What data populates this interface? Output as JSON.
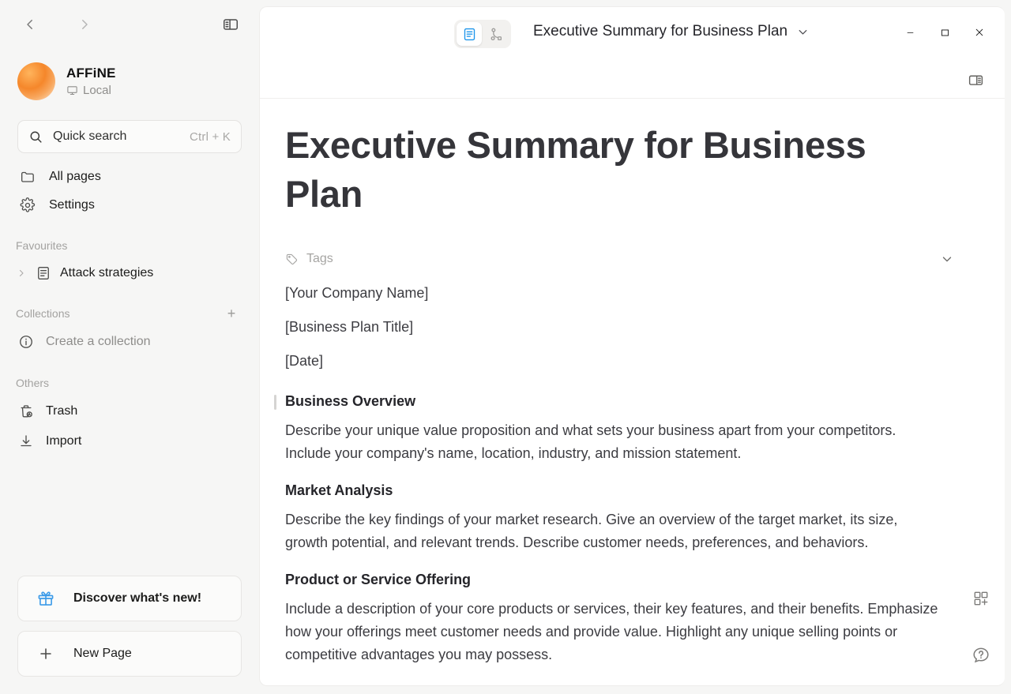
{
  "sidebar": {
    "nav_back": "back-arrow",
    "nav_forward": "forward-arrow",
    "panel_toggle": "toggle-sidebar",
    "workspace": {
      "name": "AFFiNE",
      "sub_label": "Local"
    },
    "quick_search": {
      "label": "Quick search",
      "shortcut": "Ctrl + K"
    },
    "nav_items": [
      {
        "label": "All pages",
        "icon": "folder-icon"
      },
      {
        "label": "Settings",
        "icon": "gear-icon"
      }
    ],
    "favourites": {
      "section_label": "Favourites",
      "items": [
        {
          "label": "Attack strategies",
          "icon": "doc-icon"
        }
      ]
    },
    "collections": {
      "section_label": "Collections",
      "add_label": "+",
      "items": [
        {
          "label": "Create a collection",
          "icon": "info-icon"
        }
      ]
    },
    "others": {
      "section_label": "Others",
      "items": [
        {
          "label": "Trash",
          "icon": "trash-icon"
        },
        {
          "label": "Import",
          "icon": "import-icon"
        }
      ]
    },
    "bottom": {
      "discover_label": "Discover what's new!",
      "new_page_label": "New Page"
    }
  },
  "header": {
    "mode_page": "page-mode",
    "mode_edgeless": "edgeless-mode",
    "doc_title": "Executive Summary for Business Plan",
    "minimize": "minimize",
    "maximize": "maximize",
    "close": "close",
    "right_panel_toggle": "toggle-right-sidebar"
  },
  "document": {
    "title": "Executive Summary for Business Plan",
    "tags_label": "Tags",
    "placeholders": [
      "[Your Company Name]",
      "[Business Plan Title]",
      "[Date]"
    ],
    "sections": [
      {
        "heading": "Business Overview",
        "body": "Describe your unique value proposition and what sets your business apart from your competitors. Include your company's name, location, industry, and mission statement."
      },
      {
        "heading": "Market Analysis",
        "body": "Describe the key findings of your market research. Give an overview of the target market, its size, growth potential, and relevant trends. Describe customer needs, preferences, and behaviors."
      },
      {
        "heading": "Product or Service Offering",
        "body": "Include a description of your core products or services, their key features, and their benefits. Emphasize how your offerings meet customer needs and provide value. Highlight any unique selling points or competitive advantages you may possess."
      }
    ]
  },
  "fabs": {
    "add_widget": "add-block",
    "help": "help"
  },
  "colors": {
    "accent_blue": "#1e96eb",
    "workspace_orange": "#f5872b",
    "canvas": "#f6f6f5",
    "panel": "#ffffff"
  }
}
